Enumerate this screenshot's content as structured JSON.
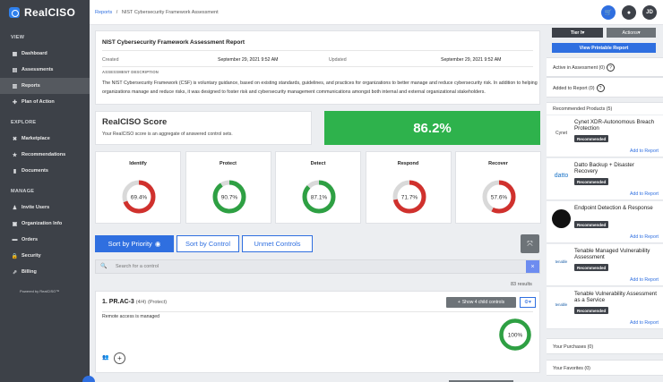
{
  "app": {
    "name": "RealCISO"
  },
  "sidebar": {
    "sections": [
      {
        "title": "VIEW",
        "items": [
          {
            "label": "Dashboard",
            "icon": "dashboard-icon",
            "active": false
          },
          {
            "label": "Assessments",
            "icon": "assessments-icon",
            "active": false
          },
          {
            "label": "Reports",
            "icon": "reports-icon",
            "active": true
          },
          {
            "label": "Plan of Action",
            "icon": "plan-icon",
            "active": false
          }
        ]
      },
      {
        "title": "EXPLORE",
        "items": [
          {
            "label": "Marketplace",
            "icon": "marketplace-icon",
            "active": false
          },
          {
            "label": "Recommendations",
            "icon": "star-icon",
            "active": false
          },
          {
            "label": "Documents",
            "icon": "document-icon",
            "active": false
          }
        ]
      },
      {
        "title": "MANAGE",
        "items": [
          {
            "label": "Invite Users",
            "icon": "users-icon",
            "active": false
          },
          {
            "label": "Organization Info",
            "icon": "organization-icon",
            "active": false
          },
          {
            "label": "Orders",
            "icon": "cart-icon",
            "active": false
          },
          {
            "label": "Security",
            "icon": "lock-icon",
            "active": false
          },
          {
            "label": "Billing",
            "icon": "billing-icon",
            "active": false
          }
        ]
      }
    ],
    "powered_by": "Powered by RealCISO™"
  },
  "breadcrumb": {
    "root": "Reports",
    "separator": "/",
    "current": "NIST Cybersecurity Framework Assessment"
  },
  "topbar": {
    "avatar_initials": "JD"
  },
  "report": {
    "title": "NIST Cybersecurity Framework Assessment Report",
    "created_label": "Created",
    "created_value": "September 29, 2021 9:52 AM",
    "updated_label": "Updated",
    "updated_value": "September 29, 2021 9:52 AM",
    "description_heading": "ASSESSMENT DESCRIPTION",
    "description": "The NIST Cybersecurity Framework (CSF) is voluntary guidance, based on existing standards, guidelines, and practices for organizations to better manage and reduce cybersecurity risk. In addition to helping organizations manage and reduce risks, it was designed to foster risk and cybersecurity management communications amongst both internal and external organizational stakeholders."
  },
  "score": {
    "title": "RealCISO Score",
    "subtitle": "Your RealCISO score is an aggregate of answered control sets.",
    "value": "86.2%"
  },
  "functions": [
    {
      "label": "Identify",
      "percent": 69.4,
      "text": "69.4%",
      "color": "#d0312d"
    },
    {
      "label": "Protect",
      "percent": 90.7,
      "text": "90.7%",
      "color": "#2ea043"
    },
    {
      "label": "Detect",
      "percent": 87.1,
      "text": "87.1%",
      "color": "#2ea043"
    },
    {
      "label": "Respond",
      "percent": 71.7,
      "text": "71.7%",
      "color": "#d0312d"
    },
    {
      "label": "Recover",
      "percent": 57.6,
      "text": "57.6%",
      "color": "#d0312d"
    }
  ],
  "tabs": [
    {
      "label": "Sort by Priority",
      "active": true,
      "icon": "eye-icon"
    },
    {
      "label": "Sort by Control",
      "active": false
    },
    {
      "label": "Unmet Controls",
      "active": false
    }
  ],
  "search": {
    "placeholder": "Search for a control",
    "clear": "×"
  },
  "results": {
    "text": "83 results"
  },
  "control": {
    "number": "1. PR.AC-3",
    "count": "(4/4)",
    "category": "(Protect)",
    "child_button": "Show 4 child controls",
    "description": "Remote access is managed",
    "percent": 100,
    "percent_text": "100%",
    "color": "#2ea043"
  },
  "right_panel": {
    "tier_label": "Tier I",
    "actions_label": "Actions",
    "printable_label": "View Printable Report",
    "active_in_assessment": "Active in Assessment (0)",
    "added_to_report": "Added to Report (0)",
    "recommended_products": "Recommended Products (5)",
    "products": [
      {
        "name": "Cynet XDR-Autonomous Breach Protection",
        "badge": "Recommended",
        "add": "Add to Report",
        "logo": "Cynet"
      },
      {
        "name": "Datto Backup + Disaster Recovery",
        "badge": "Recommended",
        "add": "Add to Report",
        "logo": "datto"
      },
      {
        "name": "Endpoint Detection & Response",
        "badge": "Recommended",
        "add": "Add to Report",
        "logo": ""
      },
      {
        "name": "Tenable Managed Vulnerability Assessment",
        "badge": "Recommended",
        "add": "Add to Report",
        "logo": "tenable"
      },
      {
        "name": "Tenable Vulnerability Assessment as a Service",
        "badge": "Recommended",
        "add": "Add to Report",
        "logo": "tenable"
      }
    ],
    "your_purchases": "Your Purchases (0)",
    "your_favorites": "Your Favorites (0)"
  }
}
